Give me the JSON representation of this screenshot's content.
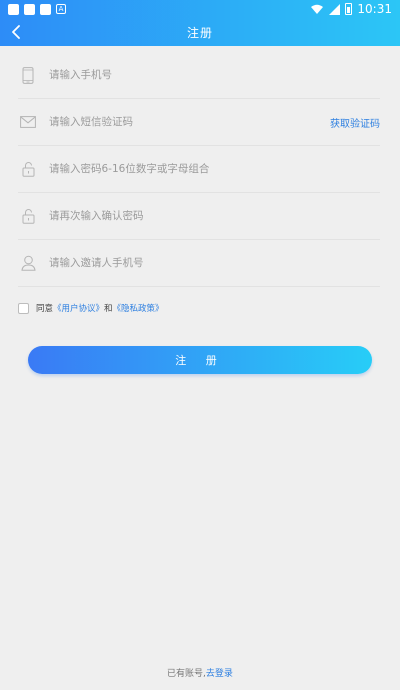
{
  "status_bar": {
    "time": "10:31",
    "notification_icon_label": "A"
  },
  "header": {
    "title": "注册"
  },
  "form": {
    "phone": {
      "placeholder": "请输入手机号",
      "value": ""
    },
    "sms_code": {
      "placeholder": "请输入短信验证码",
      "value": "",
      "get_code_label": "获取验证码"
    },
    "password": {
      "placeholder": "请输入密码6-16位数字或字母组合",
      "value": ""
    },
    "confirm_password": {
      "placeholder": "请再次输入确认密码",
      "value": ""
    },
    "invite_phone": {
      "placeholder": "请输入邀请人手机号",
      "value": ""
    }
  },
  "agreement": {
    "checked": false,
    "prefix": "同意",
    "user_agreement": "《用户协议》",
    "and": "和",
    "privacy_policy": "《隐私政策》"
  },
  "submit_label": "注 册",
  "footer": {
    "prompt": "已有账号,",
    "login_link": "去登录"
  },
  "icons": {
    "back": "chevron-left-icon",
    "phone": "phone-icon",
    "sms": "mail-icon",
    "password": "lock-icon",
    "confirm": "lock-icon",
    "invite": "user-icon"
  },
  "colors": {
    "header_gradient_start": "#2d8cf7",
    "header_gradient_end": "#2cc6f6",
    "link": "#2d7fe0",
    "background": "#efefef"
  }
}
